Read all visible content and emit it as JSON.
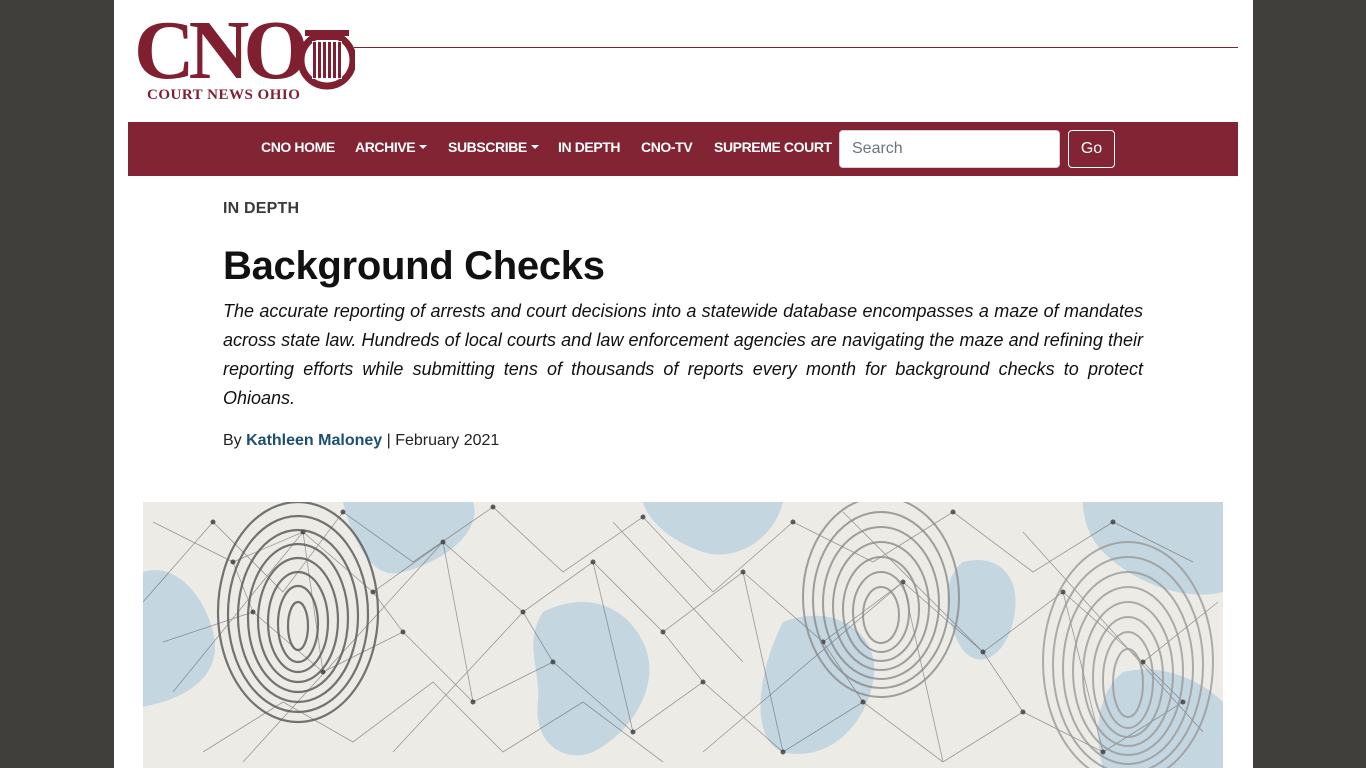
{
  "brand": {
    "logo_text": "CNO",
    "logo_subtitle": "COURT NEWS OHIO"
  },
  "nav": {
    "items": [
      {
        "label": "CNO HOME",
        "dropdown": false
      },
      {
        "label": "ARCHIVE",
        "dropdown": true
      },
      {
        "label": "SUBSCRIBE",
        "dropdown": true
      },
      {
        "label": "IN DEPTH",
        "dropdown": false
      },
      {
        "label": "CNO-TV",
        "dropdown": false
      },
      {
        "label": "SUPREME COURT",
        "dropdown": false
      }
    ],
    "search": {
      "placeholder": "Search",
      "value": ""
    },
    "go_label": "Go"
  },
  "article": {
    "category": "IN DEPTH",
    "title": "Background Checks",
    "summary": "The accurate reporting of arrests and court decisions into a statewide database encompasses a maze of mandates across state law. Hundreds of local courts and law enforcement agencies are navigating the maze and refining their reporting efforts while submitting tens of thousands of reports every month for background checks to protect Ohioans.",
    "byline_prefix": "By",
    "author": "Kathleen Maloney",
    "byline_sep": "|",
    "date": "February 2021"
  },
  "hero_image": {
    "subject": "fingerprints over world map network"
  },
  "colors": {
    "brand": "#822433",
    "page_bg": "#403f3b",
    "link": "#1c4f73"
  }
}
